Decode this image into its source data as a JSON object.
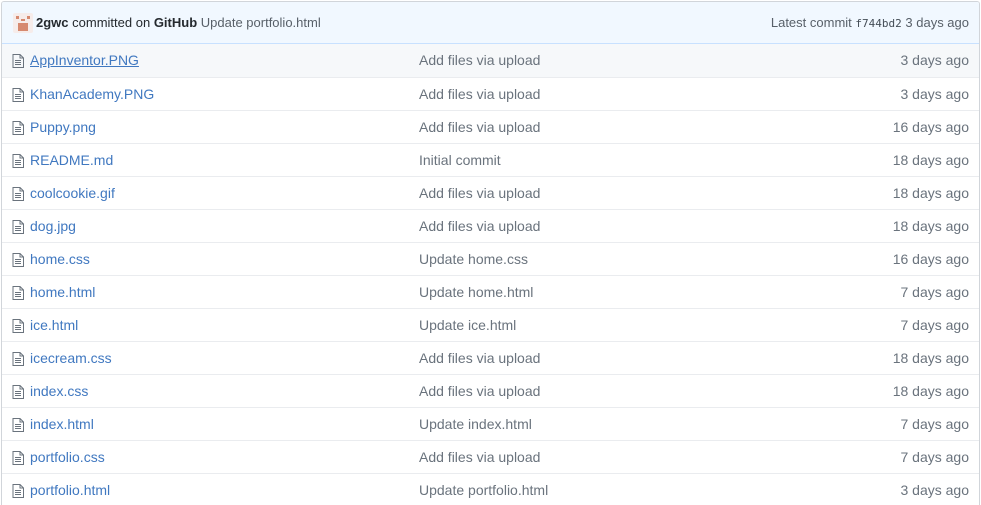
{
  "commit_tease": {
    "author": "2gwc",
    "committed_on_text": "committed on",
    "committer": "GitHub",
    "message": "Update portfolio.html",
    "latest_commit_label": "Latest commit",
    "sha": "f744bd2",
    "age": "3 days ago"
  },
  "files": [
    {
      "name": "AppInventor.PNG",
      "message": "Add files via upload",
      "age": "3 days ago"
    },
    {
      "name": "KhanAcademy.PNG",
      "message": "Add files via upload",
      "age": "3 days ago"
    },
    {
      "name": "Puppy.png",
      "message": "Add files via upload",
      "age": "16 days ago"
    },
    {
      "name": "README.md",
      "message": "Initial commit",
      "age": "18 days ago"
    },
    {
      "name": "coolcookie.gif",
      "message": "Add files via upload",
      "age": "18 days ago"
    },
    {
      "name": "dog.jpg",
      "message": "Add files via upload",
      "age": "18 days ago"
    },
    {
      "name": "home.css",
      "message": "Update home.css",
      "age": "16 days ago"
    },
    {
      "name": "home.html",
      "message": "Update home.html",
      "age": "7 days ago"
    },
    {
      "name": "ice.html",
      "message": "Update ice.html",
      "age": "7 days ago"
    },
    {
      "name": "icecream.css",
      "message": "Add files via upload",
      "age": "18 days ago"
    },
    {
      "name": "index.css",
      "message": "Add files via upload",
      "age": "18 days ago"
    },
    {
      "name": "index.html",
      "message": "Update index.html",
      "age": "7 days ago"
    },
    {
      "name": "portfolio.css",
      "message": "Add files via upload",
      "age": "7 days ago"
    },
    {
      "name": "portfolio.html",
      "message": "Update portfolio.html",
      "age": "3 days ago"
    }
  ],
  "icons": {
    "avatar": "identicon-avatar",
    "file": "file-icon"
  },
  "colors": {
    "link": "#4078c0",
    "muted": "#6a737d",
    "tease_bg": "#f1f8ff"
  }
}
